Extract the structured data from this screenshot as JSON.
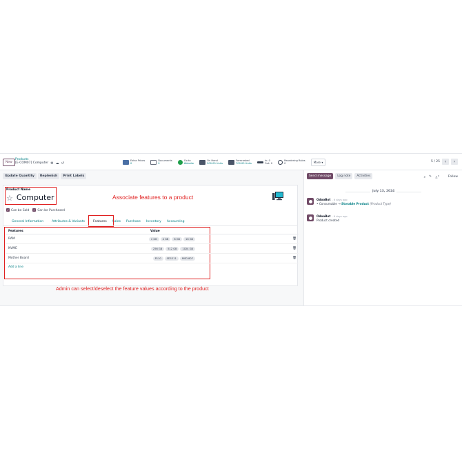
{
  "control_panel": {
    "new_label": "New",
    "breadcrumb_parent": "Products",
    "breadcrumb_current": "[E-COM07] Computer",
    "smart_buttons": [
      {
        "label": "Extra Prices",
        "value": "0",
        "color": "#4a6fa5"
      },
      {
        "label": "Documents",
        "value": "0",
        "color": "#6b7280"
      },
      {
        "label": "Go to",
        "value": "Website",
        "color": "#1e9e4a"
      },
      {
        "label": "On Hand",
        "value": "500.00 Units",
        "color": "#4a5568"
      },
      {
        "label": "Forecasted",
        "value": "700.00 Units",
        "color": "#4a5568"
      },
      {
        "label": "In: 0",
        "value": "Out: 0",
        "color": "#374151"
      },
      {
        "label": "Reordering Rules",
        "value": "0",
        "color": "#374151"
      }
    ],
    "more_label": "More ▾",
    "pager": "5 / 25"
  },
  "actions": {
    "update_quantity": "Update Quantity",
    "replenish": "Replenish",
    "print_labels": "Print Labels"
  },
  "form": {
    "product_name_label": "Product Name",
    "product_name": "Computer",
    "can_be_sold": "Can be Sold",
    "can_be_purchased": "Can be Purchased",
    "tabs": [
      "General Information",
      "Attributes & Variants",
      "Features",
      "Sales",
      "Purchase",
      "Inventory",
      "Accounting"
    ],
    "table": {
      "headers": {
        "features": "Features",
        "value": "Value"
      },
      "rows": [
        {
          "feature": "RAM",
          "values": [
            "2 GB",
            "4 GB",
            "8 GB",
            "16 GB"
          ]
        },
        {
          "feature": "NVME",
          "values": [
            "256 GB",
            "512 GB",
            "1024 GB"
          ]
        },
        {
          "feature": "Mother Board",
          "values": [
            "P110",
            "SD1211",
            "MSD 807"
          ]
        }
      ],
      "add_line": "Add a line"
    }
  },
  "annotations": {
    "top": "Associate features to a product",
    "bottom": "Admin can select/deselect the feature values according to the product"
  },
  "chatter": {
    "send_message": "Send message",
    "log_note": "Log note",
    "activities": "Activities",
    "follow": "Follow",
    "followers_count": "0",
    "date": "July 13, 2024",
    "messages": [
      {
        "author": "OdooBot",
        "ago": "- 6 days ago",
        "old": "Consumable",
        "new": "Storable Product",
        "field": "(Product Type)"
      },
      {
        "author": "OdooBot",
        "ago": "- 6 days ago",
        "text": "Product created"
      }
    ]
  }
}
